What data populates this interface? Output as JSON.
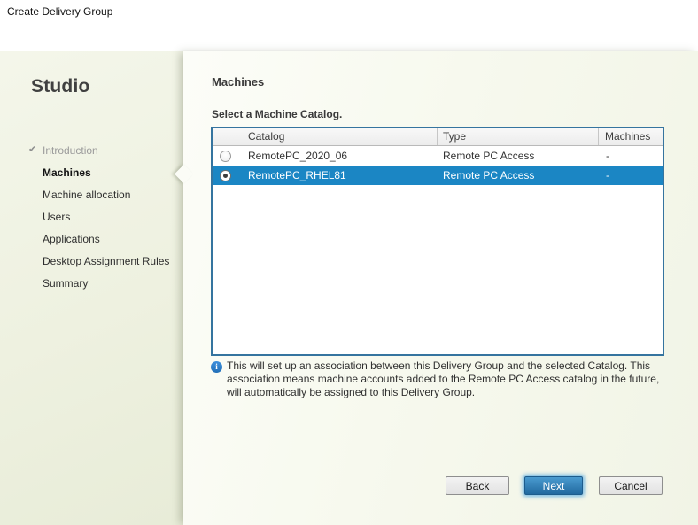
{
  "window": {
    "title": "Create Delivery Group"
  },
  "icons": {
    "completed_check": "✔",
    "info": "i"
  },
  "sidebar": {
    "brand": "Studio",
    "steps": [
      {
        "label": "Introduction",
        "state": "completed"
      },
      {
        "label": "Machines",
        "state": "current"
      },
      {
        "label": "Machine allocation",
        "state": "upcoming"
      },
      {
        "label": "Users",
        "state": "upcoming"
      },
      {
        "label": "Applications",
        "state": "upcoming"
      },
      {
        "label": "Desktop Assignment Rules",
        "state": "upcoming"
      },
      {
        "label": "Summary",
        "state": "upcoming"
      }
    ]
  },
  "main": {
    "heading": "Machines",
    "select_label": "Select a Machine Catalog.",
    "catalog_table": {
      "columns": [
        "Catalog",
        "Type",
        "Machines"
      ],
      "rows": [
        {
          "catalog": "RemotePC_2020_06",
          "type": "Remote PC Access",
          "machines": "-",
          "selected": false
        },
        {
          "catalog": "RemotePC_RHEL81",
          "type": "Remote PC Access",
          "machines": "-",
          "selected": true
        }
      ]
    },
    "info_note": {
      "lines": [
        "This will set up an association between this Delivery Group and the selected Catalog. This",
        "association means machine accounts added to the Remote PC Access catalog in the future,",
        "will automatically be assigned to this Delivery Group."
      ]
    }
  },
  "footer": {
    "back_label": "Back",
    "next_label": "Next",
    "cancel_label": "Cancel"
  },
  "colors": {
    "selected_row": "#1b86c4",
    "table_border": "#35749f",
    "next_button_top": "#4a9bd0",
    "next_button_bottom": "#21699f",
    "info_icon_blue": "#2a7ece"
  }
}
